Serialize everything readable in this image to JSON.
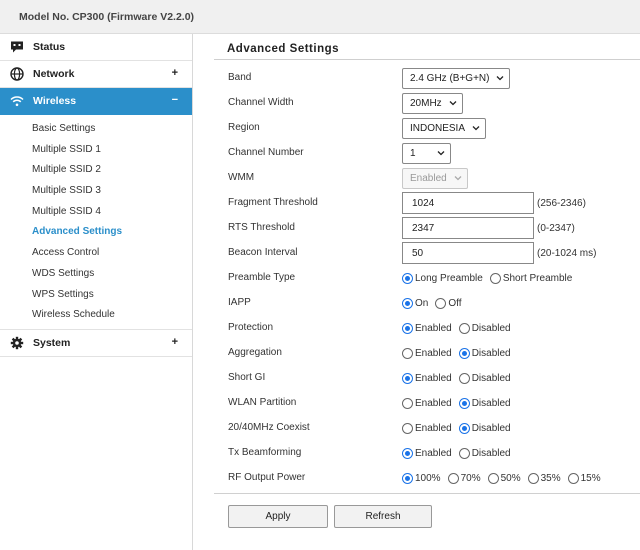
{
  "header": {
    "model": "Model No. CP300 (Firmware V2.2.0)"
  },
  "sidebar": {
    "menus": {
      "status": {
        "label": "Status",
        "icon": "message-icon"
      },
      "network": {
        "label": "Network",
        "sign": "+",
        "icon": "globe-icon"
      },
      "wireless": {
        "label": "Wireless",
        "sign": "−",
        "icon": "wifi-icon",
        "items": [
          "Basic Settings",
          "Multiple SSID 1",
          "Multiple SSID 2",
          "Multiple SSID 3",
          "Multiple SSID 4",
          "Advanced Settings",
          "Access Control",
          "WDS Settings",
          "WPS Settings",
          "Wireless Schedule"
        ],
        "current": "Advanced Settings"
      },
      "system": {
        "label": "System",
        "sign": "+",
        "icon": "gear-icon"
      }
    }
  },
  "main": {
    "title": "Advanced Settings",
    "band": {
      "label": "Band",
      "value": "2.4 GHz (B+G+N)"
    },
    "channel_width": {
      "label": "Channel Width",
      "value": "20MHz"
    },
    "region": {
      "label": "Region",
      "value": "INDONESIA"
    },
    "channel_number": {
      "label": "Channel Number",
      "value": "1"
    },
    "wmm": {
      "label": "WMM",
      "value": "Enabled"
    },
    "fragment_threshold": {
      "label": "Fragment Threshold",
      "value": "1024",
      "hint": "(256-2346)"
    },
    "rts_threshold": {
      "label": "RTS Threshold",
      "value": "2347",
      "hint": "(0-2347)"
    },
    "beacon_interval": {
      "label": "Beacon Interval",
      "value": "50",
      "hint": "(20-1024 ms)"
    },
    "preamble_type": {
      "label": "Preamble Type",
      "options": [
        "Long Preamble",
        "Short Preamble"
      ],
      "selected": "Long Preamble"
    },
    "iapp": {
      "label": "IAPP",
      "options": [
        "On",
        "Off"
      ],
      "selected": "On"
    },
    "protection": {
      "label": "Protection",
      "options": [
        "Enabled",
        "Disabled"
      ],
      "selected": "Enabled"
    },
    "aggregation": {
      "label": "Aggregation",
      "options": [
        "Enabled",
        "Disabled"
      ],
      "selected": "Disabled"
    },
    "short_gi": {
      "label": "Short GI",
      "options": [
        "Enabled",
        "Disabled"
      ],
      "selected": "Enabled"
    },
    "wlan_partition": {
      "label": "WLAN Partition",
      "options": [
        "Enabled",
        "Disabled"
      ],
      "selected": "Disabled"
    },
    "coexist": {
      "label": "20/40MHz Coexist",
      "options": [
        "Enabled",
        "Disabled"
      ],
      "selected": "Disabled"
    },
    "tx_beamforming": {
      "label": "Tx Beamforming",
      "options": [
        "Enabled",
        "Disabled"
      ],
      "selected": "Enabled"
    },
    "rf_output_power": {
      "label": "RF Output Power",
      "options": [
        "100%",
        "70%",
        "50%",
        "35%",
        "15%"
      ],
      "selected": "100%"
    }
  },
  "buttons": {
    "apply": "Apply",
    "refresh": "Refresh"
  },
  "colors": {
    "accent": "#2b8fca",
    "radio": "#1a73e8"
  }
}
